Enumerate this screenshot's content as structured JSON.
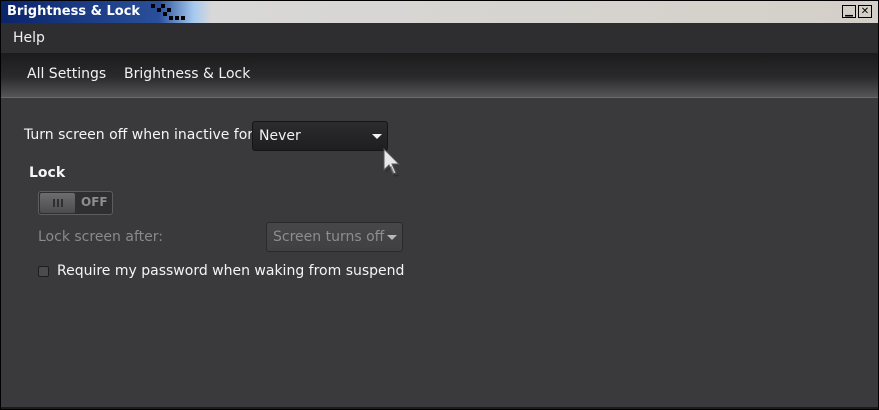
{
  "window": {
    "title": "Brightness & Lock"
  },
  "menubar": {
    "help": "Help"
  },
  "breadcrumb": {
    "all_settings": "All Settings",
    "current": "Brightness & Lock"
  },
  "screen_off": {
    "label": "Turn screen off when inactive for:",
    "value": "Never"
  },
  "lock": {
    "heading": "Lock",
    "toggle_state": "OFF",
    "lock_after_label": "Lock screen after:",
    "lock_after_value": "Screen turns off",
    "require_password_label": "Require my password when waking from suspend",
    "require_password_checked": false
  },
  "icons": {
    "minimize": "minimize-icon",
    "close": "close-icon",
    "dropdown_arrow": "chevron-down-icon",
    "cursor": "mouse-pointer-icon"
  },
  "colors": {
    "title_bar": "#0a246a",
    "background": "#3a3a3c",
    "text": "#f5f5f5",
    "disabled_text": "#8a8a8c"
  }
}
